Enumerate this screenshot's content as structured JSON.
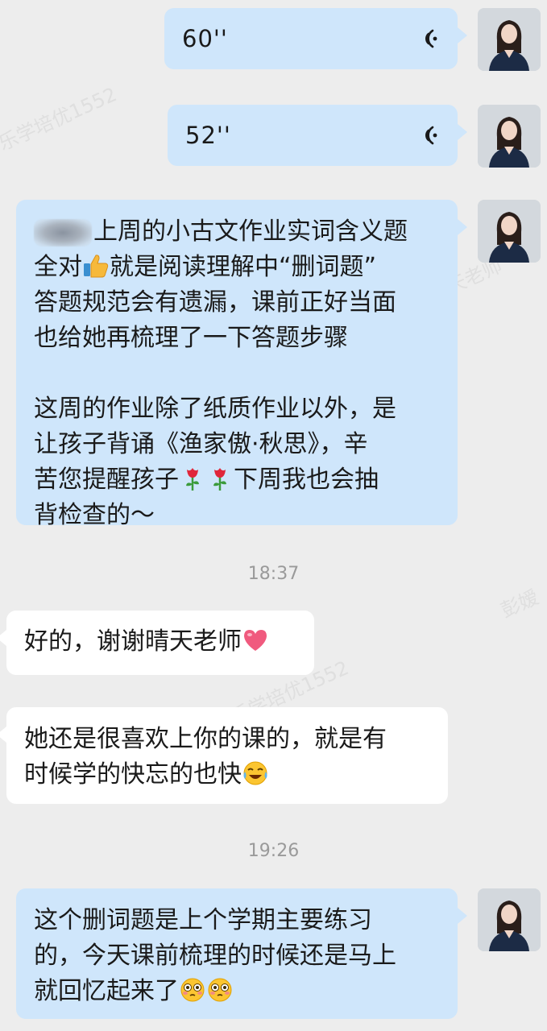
{
  "watermarks": [
    "乐学培优1552",
    "(晴天老师",
    "彭嫒",
    "乐学培优1552"
  ],
  "messages": {
    "voice1": {
      "duration": "60''"
    },
    "voice2": {
      "duration": "52''"
    },
    "teacher_msg1": {
      "line1_after_name": "上周的小古文作业实词含义题",
      "line2_a": "全对",
      "line2_b": "就是阅读理解中“删词题”",
      "line3": "答题规范会有遗漏，课前正好当面",
      "line4": "也给她再梳理了一下答题步骤",
      "line5": "这周的作业除了纸质作业以外，是",
      "line6": "让孩子背诵《渔家傲·秋思》，辛",
      "line7_a": "苦您提醒孩子",
      "line7_b": "下周我也会抽",
      "line8": "背检查的～"
    },
    "time1": "18:37",
    "parent_msg1": {
      "text": "好的，谢谢晴天老师"
    },
    "parent_msg2": {
      "line1": "她还是很喜欢上你的课的，就是有",
      "line2": "时候学的快忘的也快"
    },
    "time2": "19:26",
    "teacher_msg2": {
      "line1": "这个删词题是上个学期主要练习",
      "line2": "的，今天课前梳理的时候还是马上",
      "line3": "就回忆起来了"
    }
  },
  "colors": {
    "background": "#ededed",
    "outgoing_bubble": "#cfe6fb",
    "incoming_bubble": "#ffffff",
    "timestamp": "#9a9a9a"
  },
  "icons": {
    "voice": "voice-wave-icon",
    "thumbs_up": "thumbs-up-emoji",
    "rose": "rose-emoji",
    "heart": "heart-emoji",
    "laugh_cry": "laughing-crying-emoji",
    "shy": "shy-blush-emoji"
  }
}
